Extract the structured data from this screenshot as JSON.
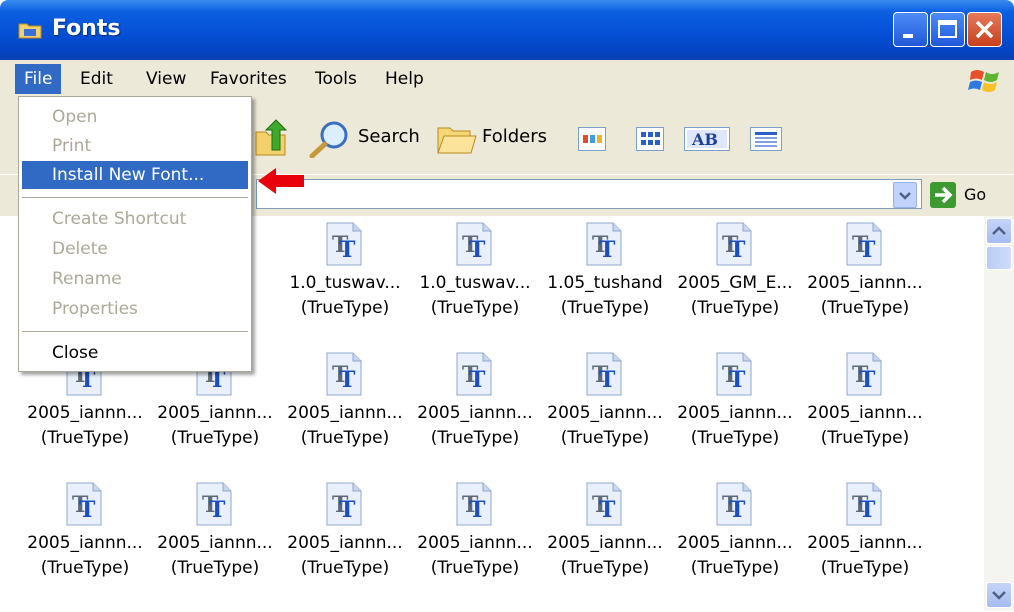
{
  "window": {
    "title": "Fonts"
  },
  "menubar": {
    "items": [
      "File",
      "Edit",
      "View",
      "Favorites",
      "Tools",
      "Help"
    ],
    "active_item": "File"
  },
  "toolbar": {
    "search_label": "Search",
    "folders_label": "Folders"
  },
  "addressbar": {
    "go_label": "Go"
  },
  "file_menu": {
    "items": [
      {
        "label": "Open",
        "state": "disabled"
      },
      {
        "label": "Print",
        "state": "disabled"
      },
      {
        "label": "Install New Font...",
        "state": "selected"
      },
      {
        "label": "Create Shortcut",
        "state": "disabled"
      },
      {
        "label": "Delete",
        "state": "disabled"
      },
      {
        "label": "Rename",
        "state": "disabled"
      },
      {
        "label": "Properties",
        "state": "disabled"
      },
      {
        "label": "Close",
        "state": "enabled"
      }
    ]
  },
  "files": [
    {
      "name": "",
      "type": ""
    },
    {
      "name": "",
      "type": ""
    },
    {
      "name": "1.0_tuswav...",
      "type": "(TrueType)"
    },
    {
      "name": "1.0_tuswav...",
      "type": "(TrueType)"
    },
    {
      "name": "1.05_tushand",
      "type": "(TrueType)"
    },
    {
      "name": "2005_GM_E...",
      "type": "(TrueType)"
    },
    {
      "name": "2005_iannn...",
      "type": "(TrueType)"
    },
    {
      "name": "2005_iannn...",
      "type": "(TrueType)"
    },
    {
      "name": "2005_iannn...",
      "type": "(TrueType)"
    },
    {
      "name": "2005_iannn...",
      "type": "(TrueType)"
    },
    {
      "name": "2005_iannn...",
      "type": "(TrueType)"
    },
    {
      "name": "2005_iannn...",
      "type": "(TrueType)"
    },
    {
      "name": "2005_iannn...",
      "type": "(TrueType)"
    },
    {
      "name": "2005_iannn...",
      "type": "(TrueType)"
    },
    {
      "name": "2005_iannn...",
      "type": "(TrueType)"
    },
    {
      "name": "2005_iannn...",
      "type": "(TrueType)"
    },
    {
      "name": "2005_iannn...",
      "type": "(TrueType)"
    },
    {
      "name": "2005_iannn...",
      "type": "(TrueType)"
    },
    {
      "name": "2005_iannn...",
      "type": "(TrueType)"
    },
    {
      "name": "2005_iannn...",
      "type": "(TrueType)"
    },
    {
      "name": "2005_iannn...",
      "type": "(TrueType)"
    }
  ],
  "file_icon_glyph": "T",
  "colors": {
    "title_bar": "#0550d6",
    "selection": "#316ac5",
    "annotation_arrow": "#e8000b"
  }
}
